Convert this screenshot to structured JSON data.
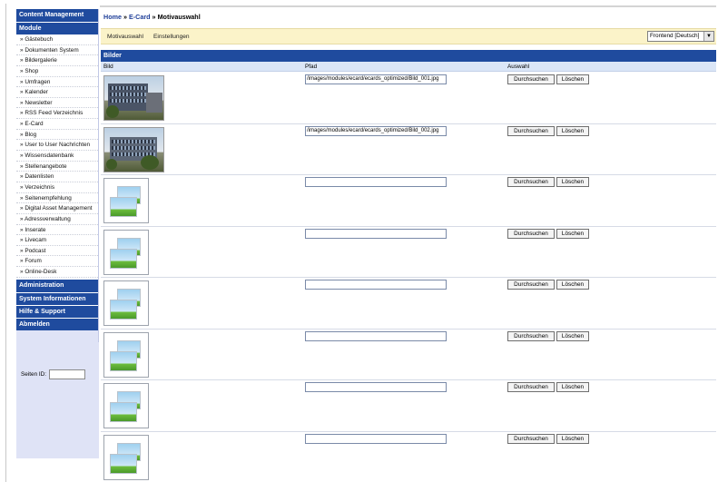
{
  "sidebar": {
    "content_management": "Content Management",
    "module": "Module",
    "modules": [
      "» Gästebuch",
      "» Dokumenten System",
      "» Bildergalerie",
      "» Shop",
      "» Umfragen",
      "» Kalender",
      "» Newsletter",
      "» RSS Feed Verzeichnis",
      "» E-Card",
      "» Blog",
      "» User to User Nachrichten",
      "» Wissensdatenbank",
      "» Stellenangebote",
      "» Datenlisten",
      "» Verzeichnis",
      "» Seitenempfehlung",
      "» Digital Asset Management",
      "» Adressverwaltung",
      "» Inserate",
      "» Livecam",
      "» Podcast",
      "» Forum",
      "» Online-Desk"
    ],
    "administration": "Administration",
    "system_info": "System Informationen",
    "help": "Hilfe & Support",
    "logout": "Abmelden",
    "page_id_label": "Seiten ID:",
    "page_id_value": ""
  },
  "breadcrumb": {
    "home": "Home",
    "sep1": " » ",
    "ecard": "E-Card",
    "sep2": " » ",
    "current": "Motivauswahl"
  },
  "tabs": {
    "motif": "Motivauswahl",
    "settings": "Einstellungen"
  },
  "language_select": {
    "selected": "Frontend [Deutsch]",
    "arrow": "▼"
  },
  "section": {
    "title": "Bilder",
    "col_image": "Bild",
    "col_path": "Pfad",
    "col_selection": "Auswahl"
  },
  "buttons": {
    "browse": "Durchsuchen",
    "delete": "Löschen"
  },
  "rows": [
    {
      "path": "/images/modules/ecard/ecards_optimized/Bild_001.jpg",
      "image": "photo"
    },
    {
      "path": "/images/modules/ecard/ecards_optimized/Bild_002.jpg",
      "image": "photo"
    },
    {
      "path": "",
      "image": "placeholder"
    },
    {
      "path": "",
      "image": "placeholder"
    },
    {
      "path": "",
      "image": "placeholder"
    },
    {
      "path": "",
      "image": "placeholder"
    },
    {
      "path": "",
      "image": "placeholder"
    },
    {
      "path": "",
      "image": "placeholder"
    }
  ],
  "colors": {
    "header_blue": "#1f4b9e",
    "sidebar_bg": "#dfe3f6",
    "tabbar_bg": "#fbf3c9",
    "column_header_bg": "#dbe6f7"
  }
}
